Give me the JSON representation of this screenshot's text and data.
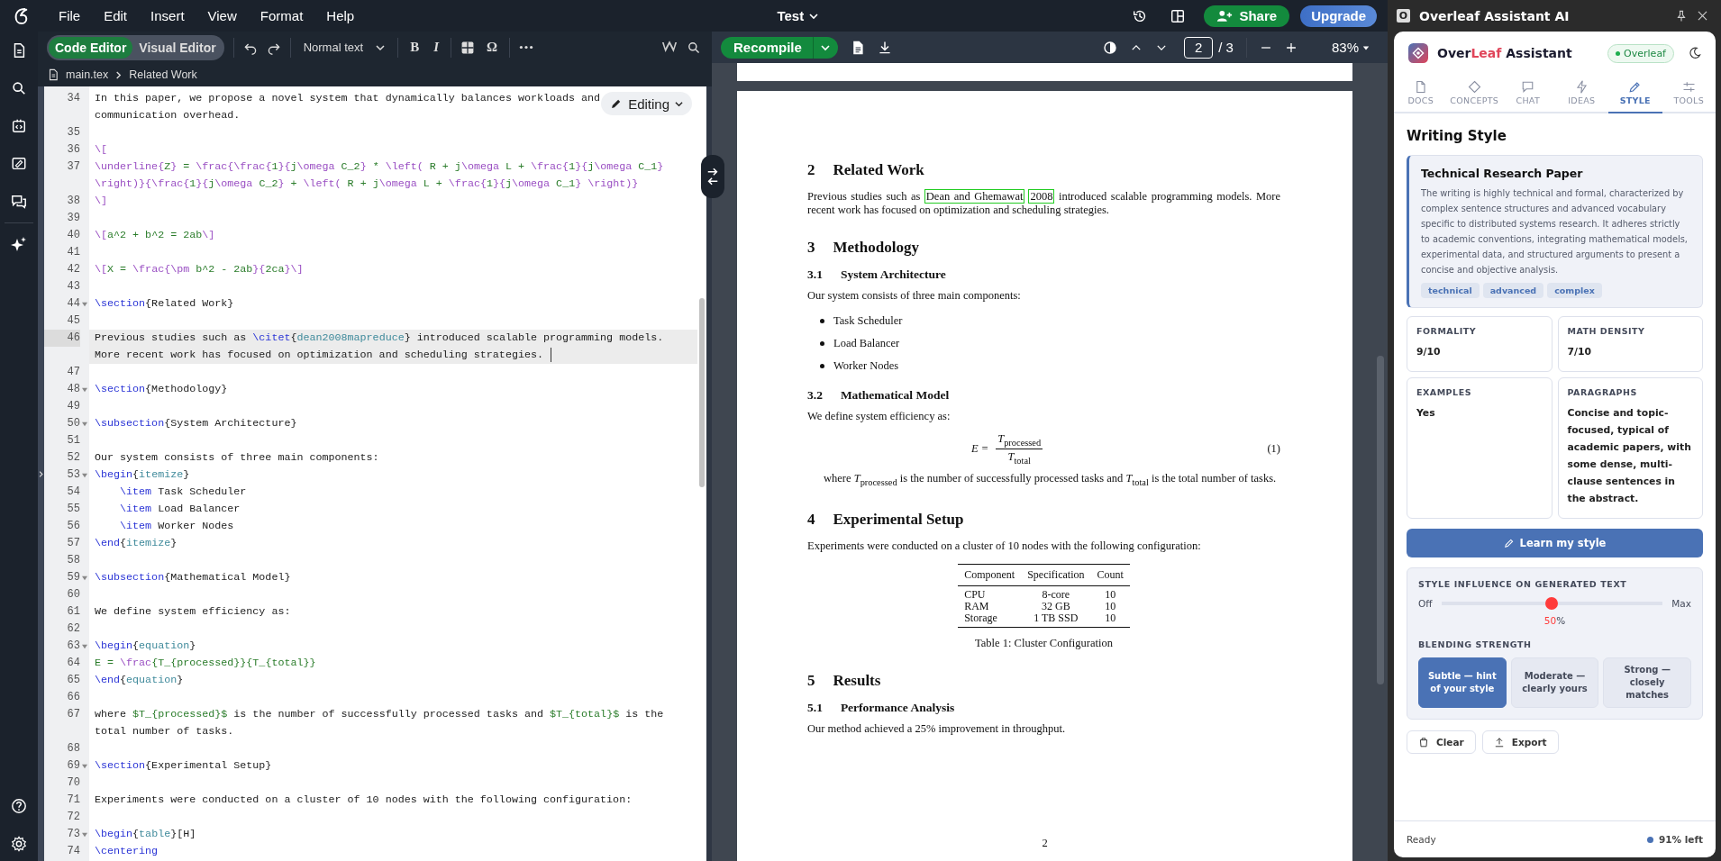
{
  "menu_bar": {
    "items": [
      "File",
      "Edit",
      "Insert",
      "View",
      "Format",
      "Help"
    ],
    "title": "Test",
    "share": "Share",
    "upgrade": "Upgrade"
  },
  "editor_toolbar": {
    "modes": [
      {
        "label": "Code Editor",
        "selected": true
      },
      {
        "label": "Visual Editor",
        "selected": false
      }
    ],
    "style_select": "Normal text",
    "format_buttons": [
      "B",
      "I"
    ],
    "symbol": "Ω"
  },
  "breadcrumb": [
    "main.tex",
    "Related Work"
  ],
  "editor": {
    "mode_badge": "Editing",
    "lines": [
      {
        "n": "34",
        "fold": false,
        "active": false,
        "rows": [
          {
            "parts": [
              {
                "kind": "text",
                "text": "In this paper, we propose a novel system that dynamically balances workloads and"
              }
            ]
          },
          {
            "parts": [
              {
                "kind": "text",
                "text": "communication overhead."
              }
            ]
          }
        ]
      },
      {
        "n": "35",
        "fold": false,
        "active": false
      },
      {
        "n": "36",
        "fold": false,
        "active": false,
        "rows": [
          {
            "parts": [
              {
                "kind": "mathcommand",
                "text": "\\["
              }
            ]
          }
        ]
      },
      {
        "n": "37",
        "fold": false,
        "active": false,
        "rows": [
          {
            "parts": [
              {
                "kind": "mathcommand",
                "text": "\\underline{"
              },
              {
                "kind": "math",
                "text": "Z"
              },
              {
                "kind": "mathcommand",
                "text": "}"
              },
              {
                "kind": "math",
                "text": " = "
              },
              {
                "kind": "mathcommand",
                "text": "\\frac{\\frac{"
              },
              {
                "kind": "math",
                "text": "1"
              },
              {
                "kind": "mathcommand",
                "text": "}{"
              },
              {
                "kind": "math",
                "text": "j"
              },
              {
                "kind": "mathcommand",
                "text": "\\omega"
              },
              {
                "kind": "math",
                "text": " C_2"
              },
              {
                "kind": "mathcommand",
                "text": "}"
              },
              {
                "kind": "math",
                "text": " * "
              },
              {
                "kind": "mathcommand",
                "text": "\\left("
              },
              {
                "kind": "math",
                "text": " R + j"
              },
              {
                "kind": "mathcommand",
                "text": "\\omega"
              },
              {
                "kind": "math",
                "text": " L + "
              },
              {
                "kind": "mathcommand",
                "text": "\\frac{"
              },
              {
                "kind": "math",
                "text": "1"
              },
              {
                "kind": "mathcommand",
                "text": "}{"
              },
              {
                "kind": "math",
                "text": "j"
              },
              {
                "kind": "mathcommand",
                "text": "\\omega"
              },
              {
                "kind": "math",
                "text": " C_1"
              },
              {
                "kind": "mathcommand",
                "text": "}"
              }
            ]
          },
          {
            "parts": [
              {
                "kind": "mathcommand",
                "text": "\\right)}{\\frac{"
              },
              {
                "kind": "math",
                "text": "1"
              },
              {
                "kind": "mathcommand",
                "text": "}{"
              },
              {
                "kind": "math",
                "text": "j"
              },
              {
                "kind": "mathcommand",
                "text": "\\omega"
              },
              {
                "kind": "math",
                "text": " C_2"
              },
              {
                "kind": "mathcommand",
                "text": "}"
              },
              {
                "kind": "math",
                "text": " + "
              },
              {
                "kind": "mathcommand",
                "text": "\\left("
              },
              {
                "kind": "math",
                "text": " R + j"
              },
              {
                "kind": "mathcommand",
                "text": "\\omega"
              },
              {
                "kind": "math",
                "text": " L + "
              },
              {
                "kind": "mathcommand",
                "text": "\\frac{"
              },
              {
                "kind": "math",
                "text": "1"
              },
              {
                "kind": "mathcommand",
                "text": "}{"
              },
              {
                "kind": "math",
                "text": "j"
              },
              {
                "kind": "mathcommand",
                "text": "\\omega"
              },
              {
                "kind": "math",
                "text": " C_1"
              },
              {
                "kind": "mathcommand",
                "text": "} \\right)}"
              }
            ]
          }
        ]
      },
      {
        "n": "38",
        "fold": false,
        "active": false,
        "rows": [
          {
            "parts": [
              {
                "kind": "mathcommand",
                "text": "\\]"
              }
            ]
          }
        ]
      },
      {
        "n": "39",
        "fold": false,
        "active": false
      },
      {
        "n": "40",
        "fold": false,
        "active": false,
        "rows": [
          {
            "parts": [
              {
                "kind": "mathcommand",
                "text": "\\["
              },
              {
                "kind": "math",
                "text": "a^2 + b^2 = 2ab"
              },
              {
                "kind": "mathcommand",
                "text": "\\]"
              }
            ]
          }
        ]
      },
      {
        "n": "41",
        "fold": false,
        "active": false
      },
      {
        "n": "42",
        "fold": false,
        "active": false,
        "rows": [
          {
            "parts": [
              {
                "kind": "mathcommand",
                "text": "\\["
              },
              {
                "kind": "math",
                "text": "X = "
              },
              {
                "kind": "mathcommand",
                "text": "\\frac{\\pm"
              },
              {
                "kind": "math",
                "text": " b^2 - 2ab"
              },
              {
                "kind": "mathcommand",
                "text": "}{"
              },
              {
                "kind": "math",
                "text": "2ca"
              },
              {
                "kind": "mathcommand",
                "text": "}\\]"
              }
            ]
          }
        ]
      },
      {
        "n": "43",
        "fold": false,
        "active": false
      },
      {
        "n": "44",
        "fold": true,
        "active": false,
        "rows": [
          {
            "parts": [
              {
                "kind": "command",
                "text": "\\section"
              },
              {
                "kind": "text",
                "text": "{Related Work}"
              }
            ]
          }
        ]
      },
      {
        "n": "45",
        "fold": false,
        "active": false
      },
      {
        "n": "46",
        "fold": false,
        "active": true,
        "rows": [
          {
            "parts": [
              {
                "kind": "text",
                "text": "Previous studies such as "
              },
              {
                "kind": "command",
                "text": "\\citet"
              },
              {
                "kind": "text",
                "text": "{"
              },
              {
                "kind": "argument",
                "text": "dean2008mapreduce"
              },
              {
                "kind": "text",
                "text": "} introduced scalable programming models."
              }
            ]
          },
          {
            "parts": [
              {
                "kind": "text",
                "text": "More recent work has focused on optimization and scheduling strategies."
              }
            ]
          }
        ]
      },
      {
        "n": "47",
        "fold": false,
        "active": false
      },
      {
        "n": "48",
        "fold": true,
        "active": false,
        "rows": [
          {
            "parts": [
              {
                "kind": "command",
                "text": "\\section"
              },
              {
                "kind": "text",
                "text": "{Methodology}"
              }
            ]
          }
        ]
      },
      {
        "n": "49",
        "fold": false,
        "active": false
      },
      {
        "n": "50",
        "fold": true,
        "active": false,
        "rows": [
          {
            "parts": [
              {
                "kind": "command",
                "text": "\\subsection"
              },
              {
                "kind": "text",
                "text": "{System Architecture}"
              }
            ]
          }
        ]
      },
      {
        "n": "51",
        "fold": false,
        "active": false
      },
      {
        "n": "52",
        "fold": false,
        "active": false,
        "rows": [
          {
            "parts": [
              {
                "kind": "text",
                "text": "Our system consists of three main components:"
              }
            ]
          }
        ]
      },
      {
        "n": "53",
        "fold": true,
        "active": false,
        "rows": [
          {
            "parts": [
              {
                "kind": "command",
                "text": "\\begin"
              },
              {
                "kind": "text",
                "text": "{"
              },
              {
                "kind": "argument",
                "text": "itemize"
              },
              {
                "kind": "text",
                "text": "}"
              }
            ]
          }
        ]
      },
      {
        "n": "54",
        "fold": false,
        "active": false,
        "rows": [
          {
            "parts": [
              {
                "kind": "command",
                "text": "    \\item"
              },
              {
                "kind": "text",
                "text": " Task Scheduler"
              }
            ]
          }
        ]
      },
      {
        "n": "55",
        "fold": false,
        "active": false,
        "rows": [
          {
            "parts": [
              {
                "kind": "command",
                "text": "    \\item"
              },
              {
                "kind": "text",
                "text": " Load Balancer"
              }
            ]
          }
        ]
      },
      {
        "n": "56",
        "fold": false,
        "active": false,
        "rows": [
          {
            "parts": [
              {
                "kind": "command",
                "text": "    \\item"
              },
              {
                "kind": "text",
                "text": " Worker Nodes"
              }
            ]
          }
        ]
      },
      {
        "n": "57",
        "fold": false,
        "active": false,
        "rows": [
          {
            "parts": [
              {
                "kind": "command",
                "text": "\\end"
              },
              {
                "kind": "text",
                "text": "{"
              },
              {
                "kind": "argument",
                "text": "itemize"
              },
              {
                "kind": "text",
                "text": "}"
              }
            ]
          }
        ]
      },
      {
        "n": "58",
        "fold": false,
        "active": false
      },
      {
        "n": "59",
        "fold": true,
        "active": false,
        "rows": [
          {
            "parts": [
              {
                "kind": "command",
                "text": "\\subsection"
              },
              {
                "kind": "text",
                "text": "{Mathematical Model}"
              }
            ]
          }
        ]
      },
      {
        "n": "60",
        "fold": false,
        "active": false
      },
      {
        "n": "61",
        "fold": false,
        "active": false,
        "rows": [
          {
            "parts": [
              {
                "kind": "text",
                "text": "We define system efficiency as:"
              }
            ]
          }
        ]
      },
      {
        "n": "62",
        "fold": false,
        "active": false
      },
      {
        "n": "63",
        "fold": true,
        "active": false,
        "rows": [
          {
            "parts": [
              {
                "kind": "command",
                "text": "\\begin"
              },
              {
                "kind": "text",
                "text": "{"
              },
              {
                "kind": "argument",
                "text": "equation"
              },
              {
                "kind": "text",
                "text": "}"
              }
            ]
          }
        ]
      },
      {
        "n": "64",
        "fold": false,
        "active": false,
        "rows": [
          {
            "parts": [
              {
                "kind": "math",
                "text": "E = "
              },
              {
                "kind": "mathcommand",
                "text": "\\frac"
              },
              {
                "kind": "math",
                "text": "{T_{processed}}{T_{total}}"
              }
            ]
          }
        ]
      },
      {
        "n": "65",
        "fold": false,
        "active": false,
        "rows": [
          {
            "parts": [
              {
                "kind": "command",
                "text": "\\end"
              },
              {
                "kind": "text",
                "text": "{"
              },
              {
                "kind": "argument",
                "text": "equation"
              },
              {
                "kind": "text",
                "text": "}"
              }
            ]
          }
        ]
      },
      {
        "n": "66",
        "fold": false,
        "active": false
      },
      {
        "n": "67",
        "fold": false,
        "active": false,
        "rows": [
          {
            "parts": [
              {
                "kind": "text",
                "text": "where "
              },
              {
                "kind": "math",
                "text": "$T_{processed}$"
              },
              {
                "kind": "text",
                "text": " is the number of successfully processed tasks and "
              },
              {
                "kind": "math",
                "text": "$T_{total}$"
              },
              {
                "kind": "text",
                "text": " is the"
              }
            ]
          },
          {
            "parts": [
              {
                "kind": "text",
                "text": "total number of tasks."
              }
            ]
          }
        ]
      },
      {
        "n": "68",
        "fold": false,
        "active": false
      },
      {
        "n": "69",
        "fold": true,
        "active": false,
        "rows": [
          {
            "parts": [
              {
                "kind": "command",
                "text": "\\section"
              },
              {
                "kind": "text",
                "text": "{Experimental Setup}"
              }
            ]
          }
        ]
      },
      {
        "n": "70",
        "fold": false,
        "active": false
      },
      {
        "n": "71",
        "fold": false,
        "active": false,
        "rows": [
          {
            "parts": [
              {
                "kind": "text",
                "text": "Experiments were conducted on a cluster of 10 nodes with the following configuration:"
              }
            ]
          }
        ]
      },
      {
        "n": "72",
        "fold": false,
        "active": false
      },
      {
        "n": "73",
        "fold": true,
        "active": false,
        "rows": [
          {
            "parts": [
              {
                "kind": "command",
                "text": "\\begin"
              },
              {
                "kind": "text",
                "text": "{"
              },
              {
                "kind": "argument",
                "text": "table"
              },
              {
                "kind": "text",
                "text": "}[H]"
              }
            ]
          }
        ]
      },
      {
        "n": "74",
        "fold": false,
        "active": false,
        "rows": [
          {
            "parts": [
              {
                "kind": "command",
                "text": "\\centering"
              }
            ]
          }
        ]
      }
    ]
  },
  "pdf_toolbar": {
    "recompile": "Recompile",
    "page": "2",
    "page_total": "/ 3",
    "zoom": "83%"
  },
  "pdf": {
    "blocks": [
      {
        "kind": "section",
        "num": "2",
        "title": "Related Work"
      },
      {
        "kind": "para",
        "indent": false,
        "parts": [
          {
            "kind": "text",
            "t": "Previous studies such as "
          },
          {
            "kind": "link",
            "t": "Dean and Ghemawat"
          },
          {
            "kind": "link",
            "t": "2008"
          },
          {
            "kind": "text",
            "t": " introduced scalable programming models. More recent work has focused on optimization and scheduling strategies."
          }
        ]
      },
      {
        "kind": "section",
        "num": "3",
        "title": "Methodology"
      },
      {
        "kind": "subsection",
        "num": "3.1",
        "title": "System Architecture"
      },
      {
        "kind": "para",
        "indent": false,
        "parts": [
          {
            "kind": "text",
            "t": "Our system consists of three main components:"
          }
        ]
      },
      {
        "kind": "list",
        "items": [
          "Task Scheduler",
          "Load Balancer",
          "Worker Nodes"
        ]
      },
      {
        "kind": "subsection",
        "num": "3.2",
        "title": "Mathematical Model"
      },
      {
        "kind": "para",
        "indent": false,
        "parts": [
          {
            "kind": "text",
            "t": "We define system efficiency as:"
          }
        ]
      },
      {
        "kind": "equation",
        "lhs": "E =",
        "numerator": "*T*$_{processed}$",
        "denominator": "*T*$_{total}$",
        "number": "(1)"
      },
      {
        "kind": "para",
        "indent": true,
        "parts": [
          {
            "kind": "text",
            "t": "where *T*$_{processed}$ is the number of successfully processed tasks and *T*$_{total}$ is the total number of tasks."
          }
        ]
      },
      {
        "kind": "section",
        "num": "4",
        "title": "Experimental Setup"
      },
      {
        "kind": "para",
        "indent": false,
        "parts": [
          {
            "kind": "text",
            "t": "Experiments were conducted on a cluster of 10 nodes with the following configuration:"
          }
        ]
      },
      {
        "kind": "table",
        "columns": [
          "Component",
          "Specification",
          "Count"
        ],
        "rows": [
          [
            "CPU",
            "8-core",
            "10"
          ],
          [
            "RAM",
            "32 GB",
            "10"
          ],
          [
            "Storage",
            "1 TB SSD",
            "10"
          ]
        ],
        "caption": "Table 1: Cluster Configuration"
      },
      {
        "kind": "section",
        "num": "5",
        "title": "Results"
      },
      {
        "kind": "subsection",
        "num": "5.1",
        "title": "Performance Analysis"
      },
      {
        "kind": "para",
        "indent": false,
        "parts": [
          {
            "kind": "text",
            "t": "Our method achieved a 25% improvement in throughput."
          }
        ]
      }
    ],
    "page_number": "2"
  },
  "assistant": {
    "window_title": "Overleaf Assistant AI",
    "window_icon_letter": "O",
    "brand": {
      "before": "Over",
      "accent": "Leaf",
      "after": " Assistant"
    },
    "status": "Overleaf",
    "tabs": [
      {
        "label": "DOCS",
        "selected": false
      },
      {
        "label": "CONCEPTS",
        "selected": false
      },
      {
        "label": "CHAT",
        "selected": false
      },
      {
        "label": "IDEAS",
        "selected": false
      },
      {
        "label": "STYLE",
        "selected": true
      },
      {
        "label": "TOOLS",
        "selected": false
      }
    ],
    "heading": "Writing Style",
    "profile": {
      "title": "Technical Research Paper",
      "description": "The writing is highly technical and formal, characterized by complex sentence structures and advanced vocabulary specific to distributed systems research. It adheres strictly to academic conventions, integrating mathematical models, experimental data, and structured arguments to present a concise and objective analysis.",
      "tags": [
        "technical",
        "advanced",
        "complex"
      ]
    },
    "stats": [
      {
        "label": "FORMALITY",
        "value": "9/10"
      },
      {
        "label": "MATH DENSITY",
        "value": "7/10"
      },
      {
        "label": "EXAMPLES",
        "value": "Yes"
      },
      {
        "label": "PARAGRAPHS",
        "value": "Concise and topic-focused, typical of academic papers, with some dense, multi-clause sentences in the abstract."
      }
    ],
    "learn_button": "Learn my style",
    "influence": {
      "label": "STYLE INFLUENCE ON GENERATED TEXT",
      "min": "Off",
      "max": "Max",
      "level": 0.5,
      "reading_value": "50",
      "reading_unit": "%"
    },
    "blending": {
      "label": "BLENDING STRENGTH",
      "options": [
        {
          "label": "Subtle — hint of your style",
          "selected": true
        },
        {
          "label": "Moderate — clearly yours",
          "selected": false
        },
        {
          "label": "Strong — closely matches",
          "selected": false
        }
      ]
    },
    "actions": [
      "Clear",
      "Export"
    ],
    "footer": {
      "status": "Ready",
      "quota": "91% left"
    }
  }
}
